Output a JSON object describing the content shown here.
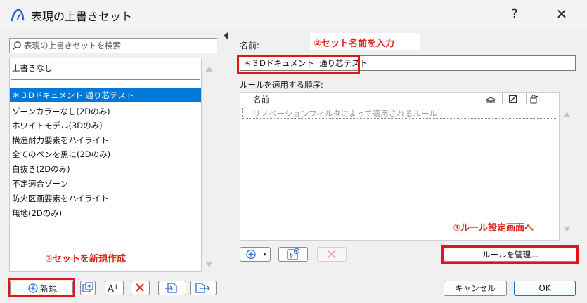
{
  "window": {
    "title": "表現の上書きセット",
    "help_label": "?",
    "close_label": "✕",
    "logo_icon": "archicad-logo-icon"
  },
  "left_panel": {
    "search_placeholder": "表現の上書きセットを検索",
    "items": [
      {
        "label": "上書きなし",
        "selected": false
      },
      {
        "label": "＊３Dドキュメント  通り芯テスト",
        "selected": true
      },
      {
        "label": "ゾーンカラーなし(2Dのみ)",
        "selected": false
      },
      {
        "label": "ホワイトモデル(3Dのみ)",
        "selected": false
      },
      {
        "label": "構造耐力要素をハイライト",
        "selected": false
      },
      {
        "label": "全てのペンを黒に(2Dのみ)",
        "selected": false
      },
      {
        "label": "白抜き(2Dのみ)",
        "selected": false
      },
      {
        "label": "不定適合ゾーン",
        "selected": false
      },
      {
        "label": "防火区画要素をハイライト",
        "selected": false
      },
      {
        "label": "無地(2Dのみ)",
        "selected": false
      }
    ],
    "toolbar": {
      "new_label": "新規",
      "rename_label": "Aᴵ"
    }
  },
  "right_panel": {
    "name_label": "名前:",
    "name_value": "＊３Dドキュメント  通り芯テスト",
    "rules_order_label": "ルールを適用する順序:",
    "table": {
      "col_name": "名前",
      "rows": [
        "リノベーションフィルタによって適用されるルール"
      ]
    },
    "manage_rules_label": "ルールを管理...",
    "cancel_label": "キャンセル",
    "ok_label": "OK"
  },
  "annotations": {
    "step1": "①セットを新規作成",
    "step2": "②セット名前を入力",
    "step3": "③ルール設定画面へ"
  },
  "colors": {
    "selection": "#0078d7",
    "annotation_red": "#e0251f"
  }
}
